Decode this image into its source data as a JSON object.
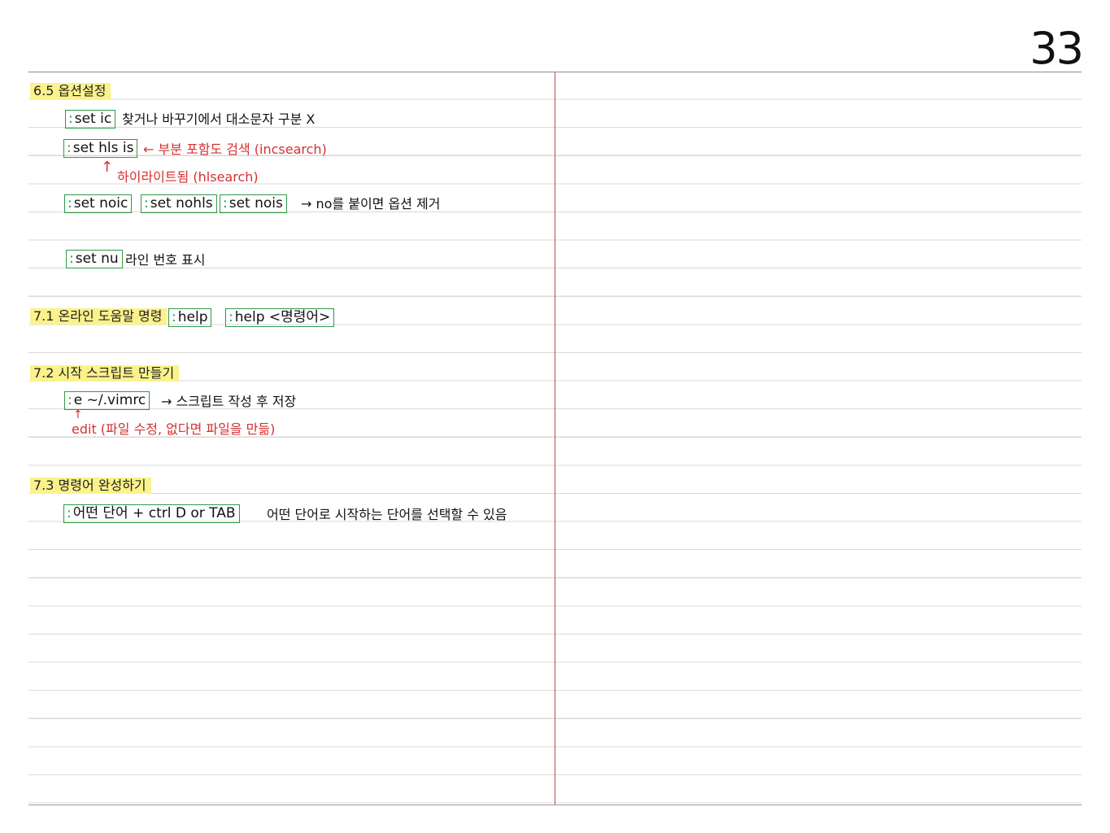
{
  "page_number": "33",
  "sections": [
    {
      "heading": "6.5 옵션설정"
    },
    {
      "heading": "7.1 온라인 도움말 명령"
    },
    {
      "heading": "7.2 시작 스크립트 만들기"
    },
    {
      "heading": "7.3 명령어 완성하기"
    }
  ],
  "notes": {
    "set_ic": {
      "cmd": "set ic",
      "desc": "찾거나 바꾸기에서 대소문자 구분 X"
    },
    "set_hls_is": {
      "cmd": "set hls is",
      "arrow_note": "← 부분 포함도 검색 (incsearch)",
      "sub_note": "하이라이트됨 (hlsearch)"
    },
    "set_no": {
      "cmd1": "set noic",
      "cmd2": "set nohls",
      "cmd3": "set nois",
      "desc": "→ no를 붙이면 옵션 제거"
    },
    "set_nu": {
      "cmd": "set nu",
      "desc": "라인 번호 표시"
    },
    "help": {
      "cmd1": "help",
      "cmd2": "help <명령어>"
    },
    "vimrc": {
      "cmd": "e ~/.vimrc",
      "desc": "→ 스크립트 작성 후 저장",
      "sub_note": "edit (파일 수정, 없다면 파일을 만듦)"
    },
    "complete": {
      "cmd": "어떤 단어 + ctrl D or TAB",
      "desc": "어떤 단어로 시작하는 단어를 선택할 수 있음"
    }
  },
  "colors": {
    "highlight": "#fbf28c",
    "box": "#2f9a45",
    "note_red": "#d6302f",
    "margin_line": "#c24848"
  }
}
